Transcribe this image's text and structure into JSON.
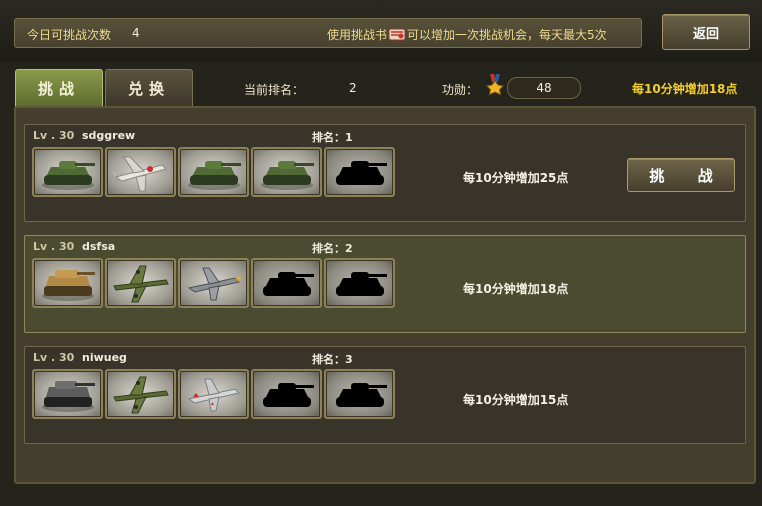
{
  "header": {
    "attempts_label": "今日可挑战次数",
    "attempts_value": "4",
    "hint_before": "使用挑战书",
    "hint_after": "可以增加一次挑战机会，每天最大5次",
    "back_label": "返回"
  },
  "tabs": {
    "challenge": "挑战",
    "exchange": "兑换"
  },
  "status": {
    "rank_label": "当前排名：",
    "rank_value": "2",
    "merit_label": "功勋：",
    "merit_value": "48",
    "gain_text": "每10分钟增加18点"
  },
  "opponents": [
    {
      "level": "Lv . 30",
      "name": "sdggrew",
      "rank": "排名：1",
      "gain": "每10分钟增加25点",
      "challenge_label": "挑 战",
      "units": [
        "green-tank-icon",
        "white-fighter-plane-icon",
        "green-tank-icon",
        "green-tank-icon",
        "locked-tank-silhouette-icon"
      ]
    },
    {
      "level": "Lv . 30",
      "name": "dsfsa",
      "rank": "排名：2",
      "gain": "每10分钟增加18点",
      "units": [
        "desert-tank-icon",
        "green-bomber-plane-icon",
        "grey-fighter-plane-icon",
        "locked-tank-silhouette-icon",
        "locked-tank-silhouette-icon"
      ]
    },
    {
      "level": "Lv . 30",
      "name": "niwueg",
      "rank": "排名：3",
      "gain": "每10分钟增加15点",
      "units": [
        "grey-tank-icon",
        "green-bomber-plane-icon",
        "silver-fighter-plane-icon",
        "locked-tank-silhouette-icon",
        "locked-tank-silhouette-icon"
      ]
    }
  ],
  "colors": {
    "accent_gold": "#f5cf2a",
    "tab_active": "#7a8a3e",
    "row_highlight": "#4a4b31"
  }
}
